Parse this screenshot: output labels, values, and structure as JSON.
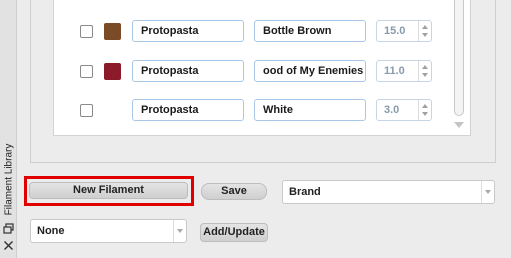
{
  "sidebar": {
    "title": "Filament Library",
    "icons": [
      "float-window-icon",
      "close-icon"
    ]
  },
  "filament_rows": [
    {
      "brand": "Protopasta",
      "name": "Bottle Brown",
      "value": "15.0",
      "color": "#7b4a26",
      "checked": false
    },
    {
      "brand": "Protopasta",
      "name": "ood of My Enemies",
      "value": "11.0",
      "color": "#8b1a2b",
      "checked": false
    },
    {
      "brand": "Protopasta",
      "name": "White",
      "value": "3.0",
      "color": "#ffffff",
      "checked": false
    }
  ],
  "buttons": {
    "new_filament": "New Filament",
    "save": "Save",
    "add_update": "Add/Update"
  },
  "dropdowns": {
    "sort_field": "Brand",
    "preset": "None"
  },
  "colors": {
    "highlight": "#e00000",
    "field_border": "#a9c7e6"
  }
}
